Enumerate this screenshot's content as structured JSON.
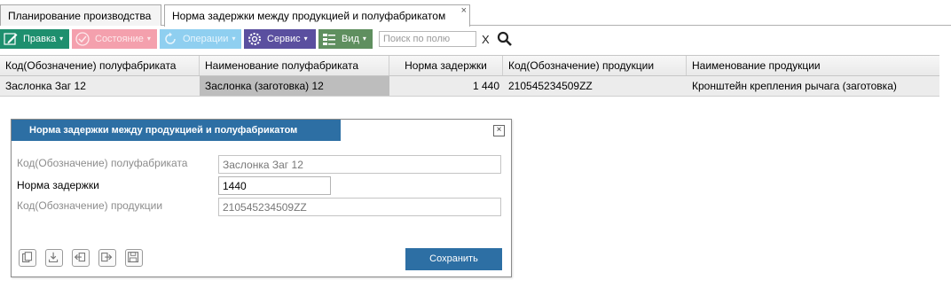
{
  "tabs": [
    {
      "label": "Планирование производства"
    },
    {
      "label": "Норма задержки между продукцией и полуфабрикатом",
      "close": "×"
    }
  ],
  "toolbar": {
    "edit_label": "Правка",
    "state_label": "Состояние",
    "ops_label": "Операции",
    "service_label": "Сервис",
    "view_label": "Вид",
    "caret": "▾",
    "search_placeholder": "Поиск по полю",
    "clear_label": "X"
  },
  "grid": {
    "columns": [
      "Код(Обозначение) полуфабриката",
      "Наименование полуфабриката",
      "Норма задержки",
      "Код(Обозначение) продукции",
      "Наименование продукции"
    ],
    "rows": [
      [
        "Заслонка Заг 12",
        "Заслонка (заготовка) 12",
        "1 440",
        "210545234509ZZ",
        "Кронштейн крепления рычага (заготовка)"
      ]
    ]
  },
  "dialog": {
    "title": "Норма задержки между продукцией и полуфабрикатом",
    "close": "×",
    "fields": [
      {
        "label": "Код(Обозначение) полуфабриката",
        "value": "Заслонка Заг 12"
      },
      {
        "label": "Норма задержки",
        "value": "1440"
      },
      {
        "label": "Код(Обозначение) продукции",
        "value": "210545234509ZZ"
      }
    ],
    "save_label": "Сохранить"
  },
  "colors": {
    "accent": "#2d6fa4",
    "edit": "#1e8f6e",
    "state": "#f4a0ad",
    "ops": "#8fcff0",
    "service": "#5a4f9f",
    "view": "#5f8f5f"
  }
}
